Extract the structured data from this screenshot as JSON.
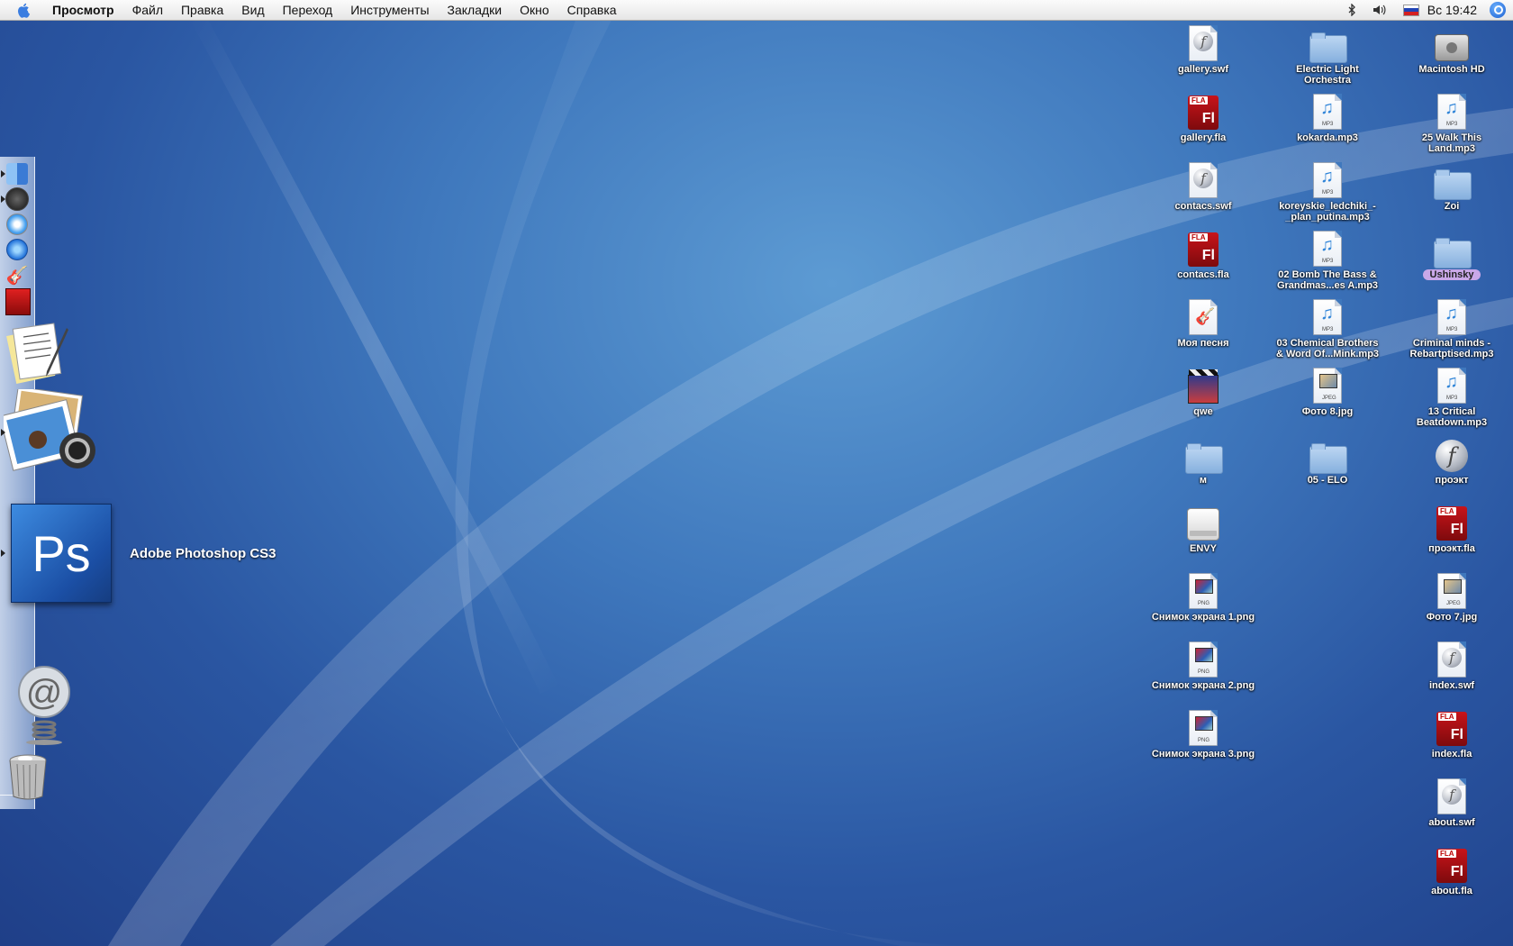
{
  "menubar": {
    "app_name": "Просмотр",
    "items": [
      "Файл",
      "Правка",
      "Вид",
      "Переход",
      "Инструменты",
      "Закладки",
      "Окно",
      "Справка"
    ],
    "clock": "Вс 19:42"
  },
  "dock": {
    "hover_label": "Adobe Photoshop CS3",
    "items": [
      "Finder",
      "Front Row",
      "Safari",
      "QuickTime Player",
      "GarageBand",
      "Photo Booth",
      "TextEdit",
      "Preview",
      "Adobe Photoshop CS3",
      "Mail",
      "Trash"
    ]
  },
  "desktop": {
    "col1": [
      {
        "label": "gallery.swf",
        "type": "swf"
      },
      {
        "label": "gallery.fla",
        "type": "fla"
      },
      {
        "label": "contacs.swf",
        "type": "swf"
      },
      {
        "label": "contacs.fla",
        "type": "fla"
      },
      {
        "label": "Моя песня",
        "type": "garageband"
      },
      {
        "label": "qwe",
        "type": "movie"
      },
      {
        "label": "м",
        "type": "folder"
      },
      {
        "label": "ENVY",
        "type": "drive"
      },
      {
        "label": "Снимок экрана 1.png",
        "type": "png"
      },
      {
        "label": "Снимок экрана 2.png",
        "type": "png"
      },
      {
        "label": "Снимок экрана 3.png",
        "type": "png"
      }
    ],
    "col2": [
      {
        "label": "Electric Light\nOrchestra",
        "type": "folder"
      },
      {
        "label": "kokarda.mp3",
        "type": "mp3"
      },
      {
        "label": "koreyskie_ledchiki_-\n_plan_putina.mp3",
        "type": "mp3"
      },
      {
        "label": "02 Bomb The Bass &\nGrandmas...es A.mp3",
        "type": "mp3"
      },
      {
        "label": "03 Chemical Brothers\n& Word Of...Mink.mp3",
        "type": "mp3"
      },
      {
        "label": "Фото 8.jpg",
        "type": "jpg"
      },
      {
        "label": "05 - ELO",
        "type": "folder"
      }
    ],
    "col3": [
      {
        "label": "Macintosh HD",
        "type": "hd"
      },
      {
        "label": "25 Walk This\nLand.mp3",
        "type": "mp3"
      },
      {
        "label": "Zoi",
        "type": "folder"
      },
      {
        "label": "Ushinsky",
        "type": "folder",
        "tag": "#c9a8e8"
      },
      {
        "label": "Criminal minds -\nRebartptised.mp3",
        "type": "mp3"
      },
      {
        "label": "13 Critical\nBeatdown.mp3",
        "type": "mp3"
      },
      {
        "label": "проэкт",
        "type": "flash-app"
      },
      {
        "label": "проэкт.fla",
        "type": "fla"
      },
      {
        "label": "Фото 7.jpg",
        "type": "jpg"
      },
      {
        "label": "index.swf",
        "type": "swf"
      },
      {
        "label": "index.fla",
        "type": "fla"
      },
      {
        "label": "about.swf",
        "type": "swf"
      },
      {
        "label": "about.fla",
        "type": "fla"
      }
    ]
  },
  "icon_text": {
    "fla_tag": "FLA",
    "fla_mark": "Fl",
    "mp3_tag": "MP3",
    "jpg_tag": "JPEG",
    "png_tag": "PNG",
    "swf_mark": "f",
    "ps_mark": "Ps"
  },
  "colors": {
    "desktop_blue": "#2a56a2",
    "menubar": "#eeeeee",
    "fla_red": "#b3121a"
  }
}
